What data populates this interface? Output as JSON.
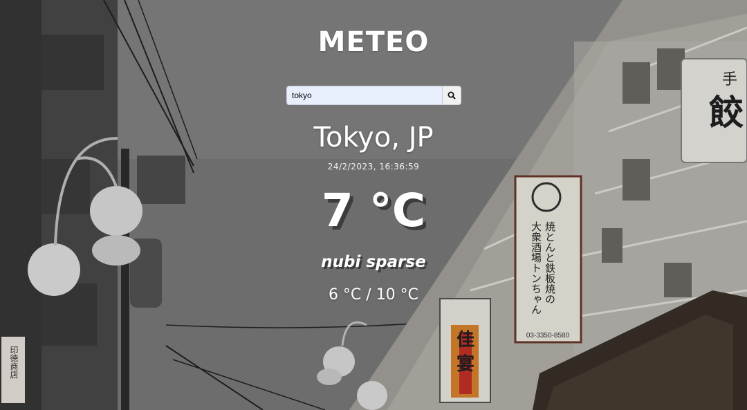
{
  "app": {
    "title": "METEO"
  },
  "search": {
    "value": "tokyo",
    "icon": "search-icon"
  },
  "weather": {
    "location": "Tokyo, JP",
    "datetime": "24/2/2023, 16:36:59",
    "temperature": "7 °C",
    "description": "nubi sparse",
    "min_max": "6 °C / 10 °C"
  },
  "background": {
    "sign_left_text": "焼とんと鉄板焼の 大衆酒場トンちゃん",
    "sign_phone": "03-3350-8580",
    "sign_center": "佳宴",
    "sign_right": "手餃",
    "sign_far_left": "印徳商店"
  },
  "colors": {
    "search_bg": "#e8f0fe",
    "text": "#ffffff",
    "shadow": "#3c3c3c"
  }
}
